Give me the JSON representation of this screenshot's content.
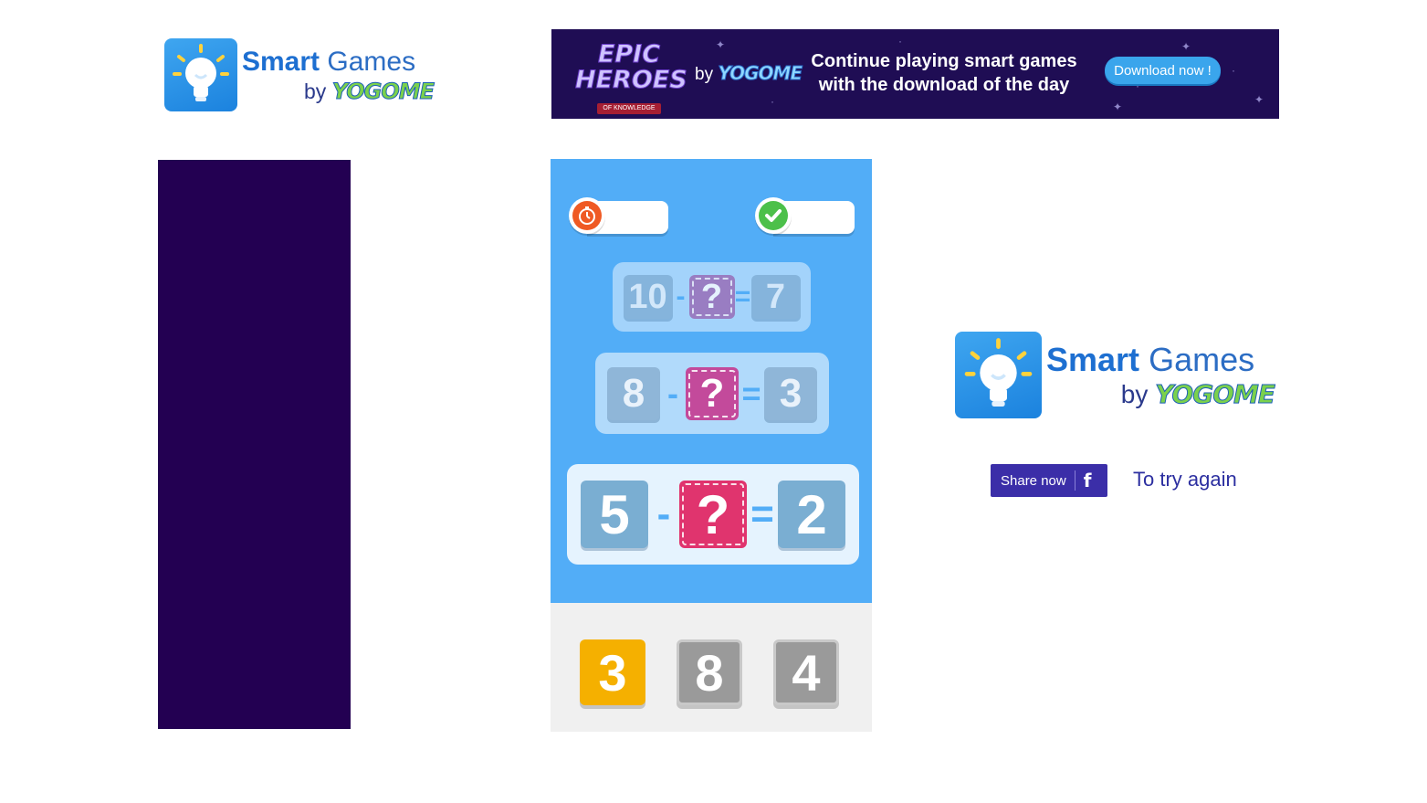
{
  "brand": {
    "name_bold": "Smart",
    "name_regular": "Games",
    "by": "by",
    "publisher": "YOGOME",
    "icon": "lightbulb-icon"
  },
  "banner": {
    "game_title_line1": "EPIC",
    "game_title_line2": "HEROES",
    "game_subtitle": "OF KNOWLEDGE",
    "by": "by",
    "publisher": "YOGOME",
    "message_line1": "Continue playing smart games",
    "message_line2": "with the download of the day",
    "button_label": "Download now !"
  },
  "game": {
    "timer_icon": "stopwatch-icon",
    "score_icon": "checkmark-icon",
    "equations": [
      {
        "a": "10",
        "op": "-",
        "unknown": "?",
        "eq": "=",
        "result": "7"
      },
      {
        "a": "8",
        "op": "-",
        "unknown": "?",
        "eq": "=",
        "result": "3"
      },
      {
        "a": "5",
        "op": "-",
        "unknown": "?",
        "eq": "=",
        "result": "2"
      }
    ],
    "choices": [
      "3",
      "8",
      "4"
    ]
  },
  "share": {
    "button_label": "Share now",
    "button_icon": "facebook-icon",
    "icon_glyph": "f",
    "retry_label": "To try again"
  },
  "colors": {
    "game_blue": "#52adf7",
    "ad_purple": "#230052",
    "banner_bg": "#1f0d54",
    "choice_correct": "#f5b000",
    "choice_inactive": "#9a9a9a",
    "unknown_pink": "#e0346e"
  }
}
